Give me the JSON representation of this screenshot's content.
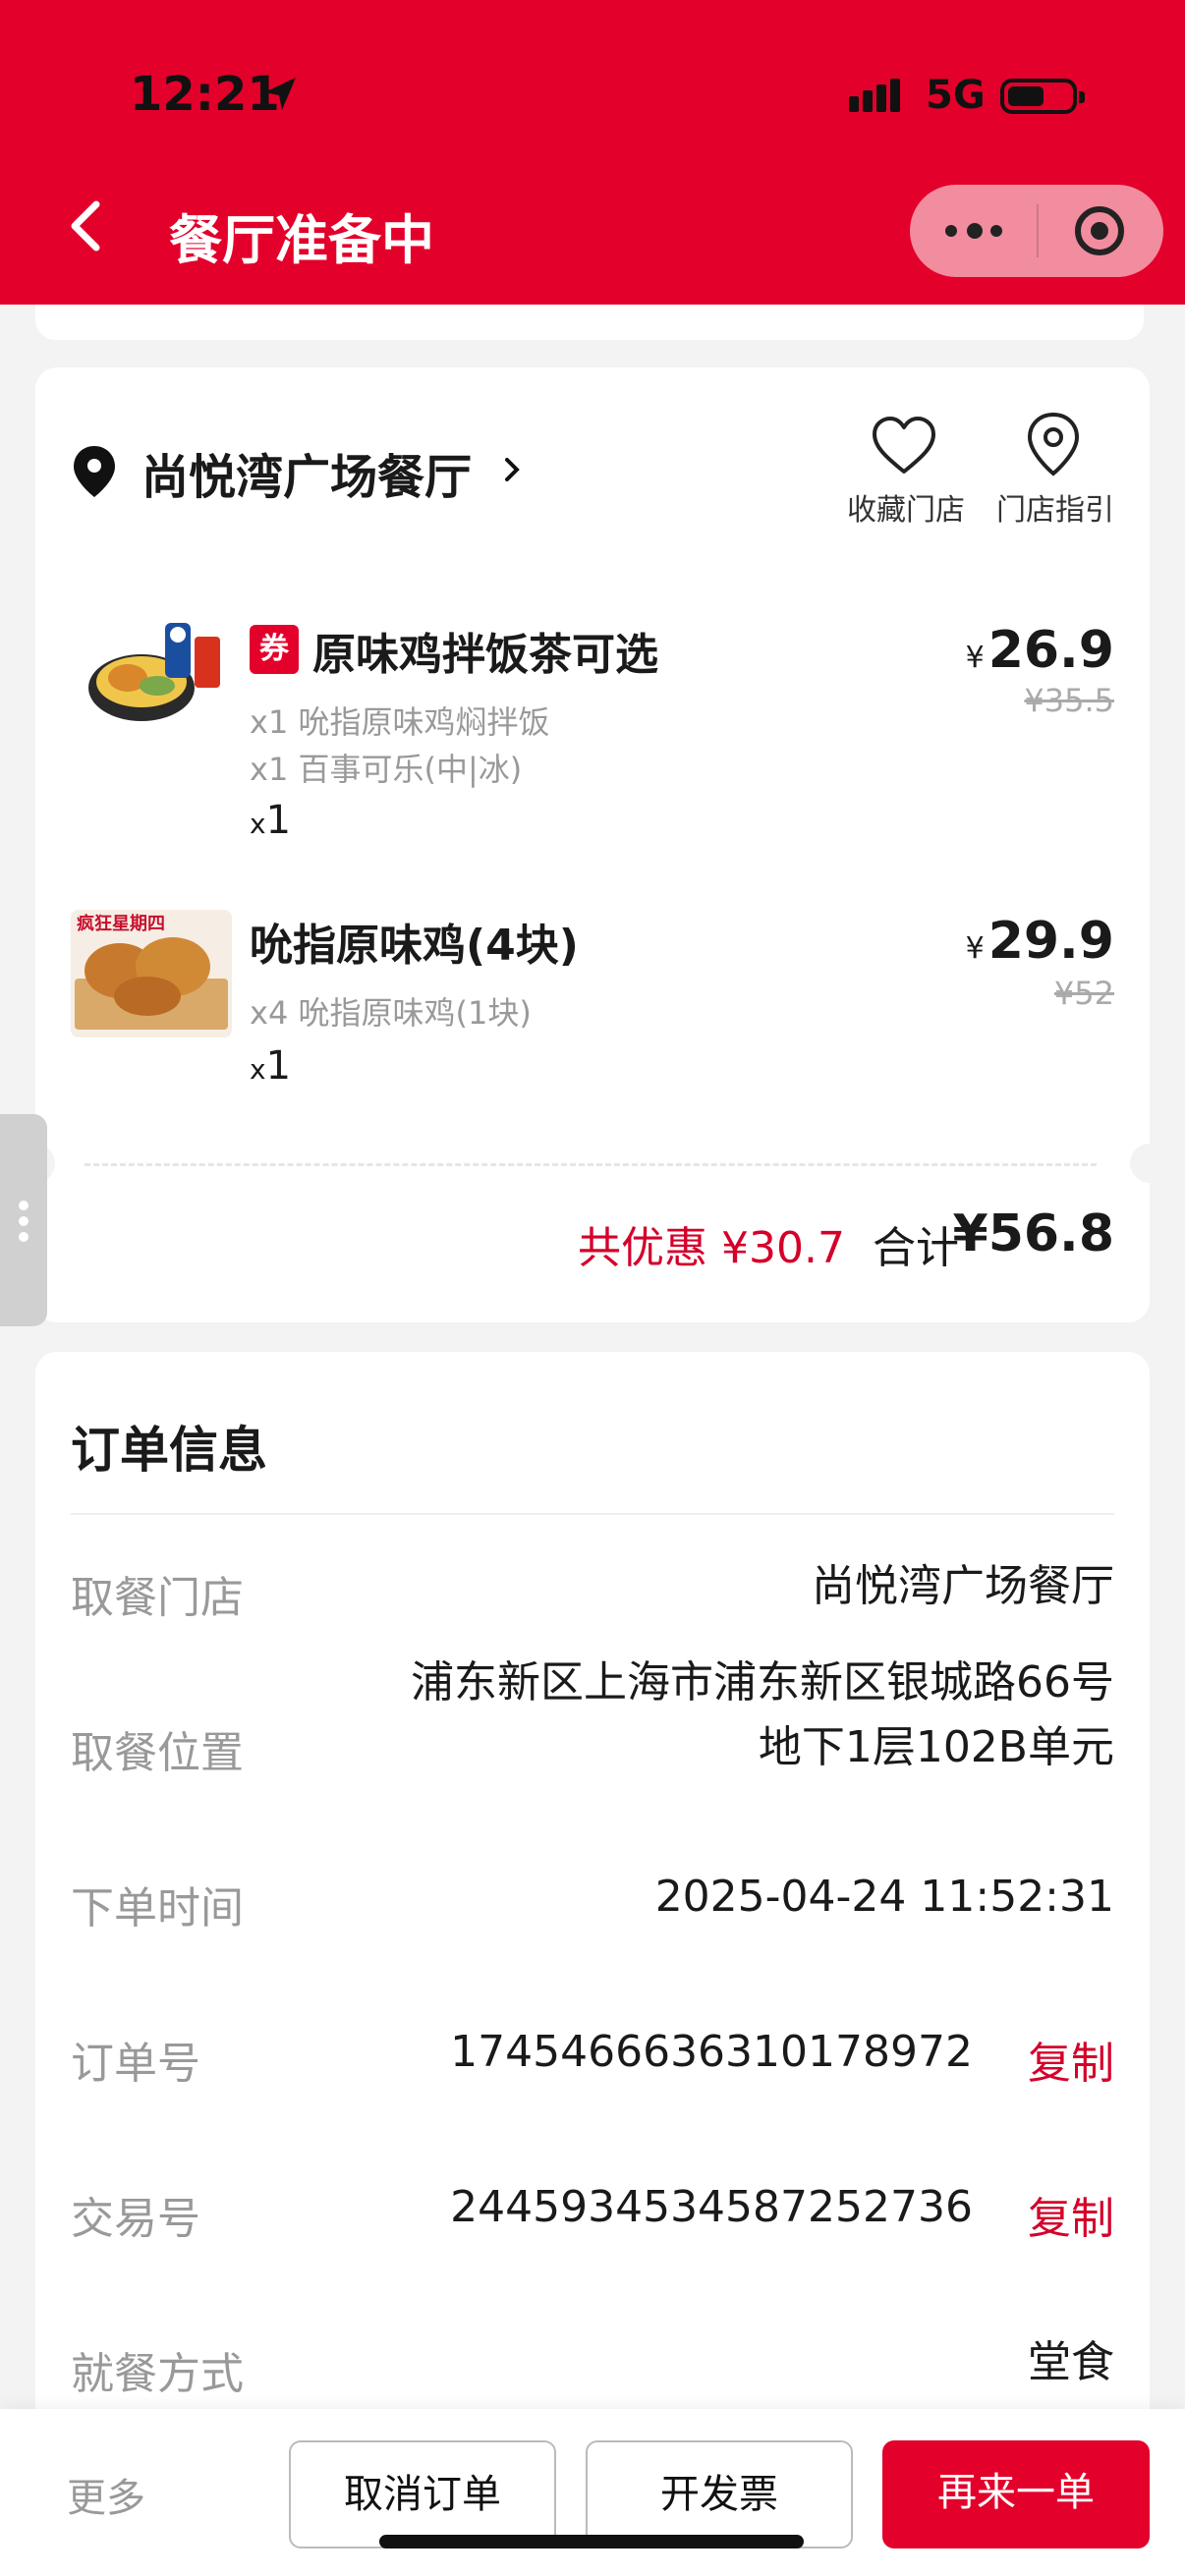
{
  "status_bar": {
    "time": "12:21",
    "network": "5G"
  },
  "header": {
    "title": "餐厅准备中"
  },
  "store": {
    "name": "尚悦湾广场餐厅",
    "favorite_label": "收藏门店",
    "guide_label": "门店指引"
  },
  "items": [
    {
      "coupon_tag": "券",
      "name": "原味鸡拌饭茶可选",
      "details": [
        "x1 吮指原味鸡焖拌饭",
        "x1 百事可乐(中|冰)"
      ],
      "qty_prefix": "x",
      "qty": "1",
      "currency": "¥",
      "price": "26.9",
      "original_price": "¥35.5"
    },
    {
      "name": "吮指原味鸡(4块)",
      "details": [
        "x4 吮指原味鸡(1块)"
      ],
      "qty_prefix": "x",
      "qty": "1",
      "currency": "¥",
      "price": "29.9",
      "original_price": "¥52"
    }
  ],
  "summary": {
    "discount": "共优惠 ¥30.7",
    "total_label": "合计",
    "total": "¥56.8"
  },
  "order_info": {
    "title": "订单信息",
    "rows": [
      {
        "label": "取餐门店",
        "value": "尚悦湾广场餐厅"
      },
      {
        "label": "取餐位置",
        "value_line1": "浦东新区上海市浦东新区银城路66号",
        "value_line2": "地下1层102B单元"
      },
      {
        "label": "下单时间",
        "value": "2025-04-24 11:52:31"
      },
      {
        "label": "订单号",
        "value": "1745466636310178972",
        "action": "复制"
      },
      {
        "label": "交易号",
        "value": "2445934534587252736",
        "action": "复制"
      },
      {
        "label": "就餐方式",
        "value": "堂食"
      }
    ]
  },
  "bottom_bar": {
    "more": "更多",
    "cancel": "取消订单",
    "invoice": "开发票",
    "reorder": "再来一单"
  },
  "colors": {
    "brand_red": "#e3002b",
    "accent_red": "#d4002a"
  }
}
